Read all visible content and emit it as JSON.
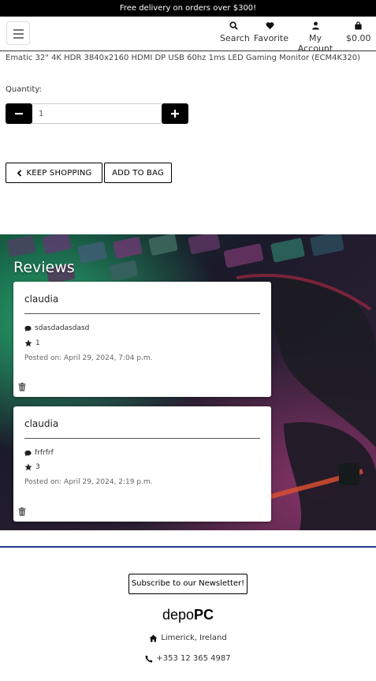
{
  "promo_banner": {
    "text": "Free delivery on orders over $300!"
  },
  "nav": {
    "menu_icon": "hamburger-icon",
    "links": [
      {
        "label": "Search",
        "icon": "search-icon"
      },
      {
        "label": "Favorite",
        "icon": "heart-icon"
      },
      {
        "label": "My Account",
        "icon": "user-icon"
      },
      {
        "label": "$0.00",
        "icon": "shopping-bag-icon"
      }
    ]
  },
  "product": {
    "name": "Ematic 32\" 4K HDR 3840x2160 HDMI DP USB 60hz 1ms LED Gaming Monitor (ECM4K320)",
    "quantity_label": "Quantity:",
    "quantity_value": "1",
    "decrement_icon": "minus-icon",
    "increment_icon": "plus-icon"
  },
  "actions": {
    "keep_shopping": "KEEP SHOPPING",
    "add_to_bag": "ADD TO BAG"
  },
  "reviews": {
    "title": "Reviews",
    "items": [
      {
        "author": "claudia",
        "comment": "sdasdadasdasd",
        "rating": "1",
        "posted": "Posted on: April 29, 2024, 7:04 p.m."
      },
      {
        "author": "claudia",
        "comment": "frfrfrf",
        "rating": "3",
        "posted": "Posted on: April 29, 2024, 2:19 p.m."
      }
    ]
  },
  "footer": {
    "newsletter_button": "Subscribe to our Newsletter!",
    "brand_light": "depo",
    "brand_bold": "PC",
    "address": "Limerick, Ireland",
    "phone": "+353 12 365 4987"
  },
  "colors": {
    "accent_rule": "#1e3a8a",
    "button_dark": "#000000"
  }
}
